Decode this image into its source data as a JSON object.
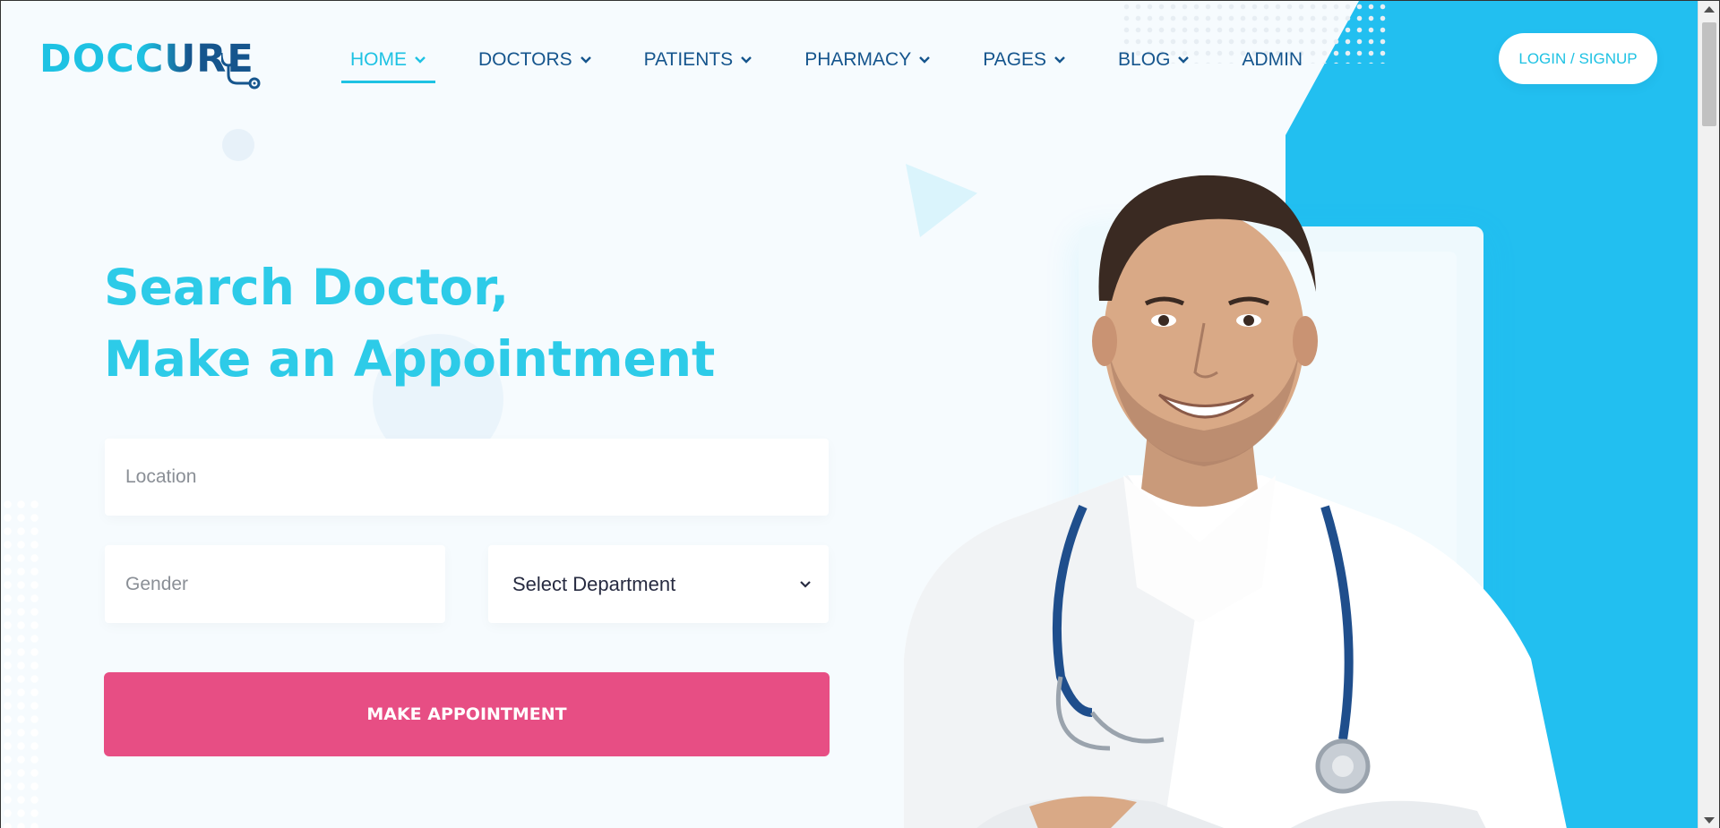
{
  "logo": {
    "text": "DOCCURE",
    "icon": "stethoscope-icon"
  },
  "nav": {
    "items": [
      {
        "label": "HOME",
        "has_dropdown": true,
        "active": true
      },
      {
        "label": "DOCTORS",
        "has_dropdown": true,
        "active": false
      },
      {
        "label": "PATIENTS",
        "has_dropdown": true,
        "active": false
      },
      {
        "label": "PHARMACY",
        "has_dropdown": true,
        "active": false
      },
      {
        "label": "PAGES",
        "has_dropdown": true,
        "active": false
      },
      {
        "label": "BLOG",
        "has_dropdown": true,
        "active": false
      },
      {
        "label": "ADMIN",
        "has_dropdown": false,
        "active": false
      }
    ],
    "login_label": "LOGIN / SIGNUP"
  },
  "hero": {
    "title_line1": "Search Doctor,",
    "title_line2": "Make an Appointment"
  },
  "form": {
    "location_placeholder": "Location",
    "gender_placeholder": "Gender",
    "department_selected": "Select Department",
    "submit_label": "MAKE APPOINTMENT"
  },
  "colors": {
    "primary_cyan": "#1ec2e3",
    "navy": "#15558d",
    "accent_pink": "#e74e84",
    "blue_panel": "#22bff0",
    "background": "#f6fbfe"
  }
}
